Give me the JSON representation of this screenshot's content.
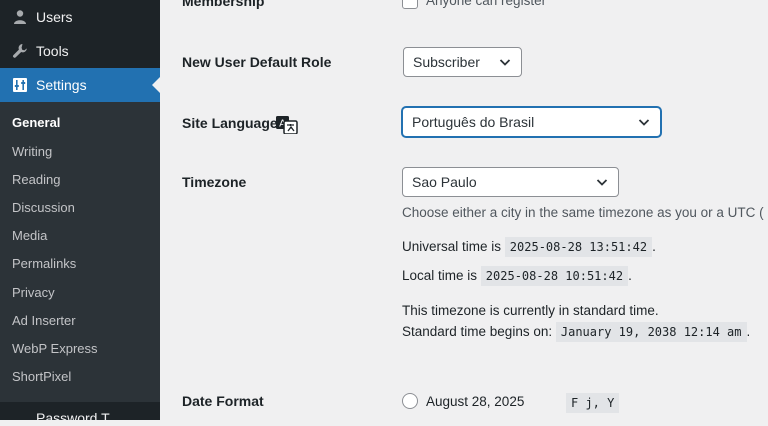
{
  "sidebar": {
    "items": [
      {
        "label": "Users",
        "icon": "users-icon"
      },
      {
        "label": "Tools",
        "icon": "wrench-icon"
      },
      {
        "label": "Settings",
        "icon": "settings-icon"
      }
    ],
    "submenu": [
      "General",
      "Writing",
      "Reading",
      "Discussion",
      "Media",
      "Permalinks",
      "Privacy",
      "Ad Inserter",
      "WebP Express",
      "ShortPixel"
    ],
    "cut_item": "Password T"
  },
  "settings": {
    "membership": {
      "label": "Membership",
      "checkbox_label": "Anyone can register"
    },
    "default_role": {
      "label": "New User Default Role",
      "value": "Subscriber"
    },
    "site_language": {
      "label": "Site Language",
      "value": "Português do Brasil"
    },
    "timezone": {
      "label": "Timezone",
      "value": "Sao Paulo",
      "description": "Choose either a city in the same timezone as you or a UTC (",
      "universal_label": "Universal time is",
      "universal_time": "2025-08-28 13:51:42",
      "local_label": "Local time is",
      "local_time": "2025-08-28 10:51:42",
      "standard_note": "This timezone is currently in standard time.",
      "standard_begins_label": "Standard time begins on:",
      "standard_begins": "January 19, 2038 12:14 am"
    },
    "date_format": {
      "label": "Date Format",
      "option": "August 28, 2025",
      "code": "F j, Y"
    }
  },
  "colors": {
    "sidebar": "#1d2327",
    "submenu": "#2c3338",
    "accent": "#2271b1"
  }
}
